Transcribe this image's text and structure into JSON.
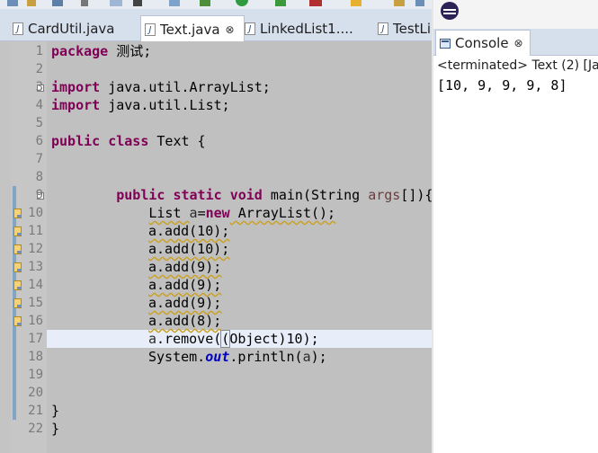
{
  "editor": {
    "tabs": [
      {
        "label": "CardUtil.java",
        "active": false
      },
      {
        "label": "Text.java",
        "active": true,
        "close": "⊗"
      },
      {
        "label": "LinkedList1....",
        "active": false
      },
      {
        "label": "TestLi",
        "active": false
      }
    ],
    "line_numbers": [
      "1",
      "2",
      "3",
      "4",
      "5",
      "6",
      "7",
      "8",
      "9",
      "10",
      "11",
      "12",
      "13",
      "14",
      "15",
      "16",
      "17",
      "18",
      "19",
      "20",
      "21",
      "22"
    ],
    "code": {
      "l1_kw": "package",
      "l1_rest": " 测试;",
      "l3_kw": "import",
      "l3_rest": " java.util.ArrayList;",
      "l4_kw": "import",
      "l4_rest": " java.util.List;",
      "l6_kw1": "public",
      "l6_kw2": "class",
      "l6_rest": " Text {",
      "l9_indent": "        ",
      "l9_kw1": "public",
      "l9_kw2": "static",
      "l9_kw3": "void",
      "l9_mid": " main(String ",
      "l9_par": "args",
      "l9_end": "[]){",
      "l10_indent": "            ",
      "l10_a": "List ",
      "l10_b": "a",
      "l10_c": "=",
      "l10_kw": "new",
      "l10_d": " ArrayList();",
      "l11": "a.add(10);",
      "l12": "a.add(10);",
      "l13": "a.add(9);",
      "l14": "a.add(9);",
      "l15": "a.add(9);",
      "l16": "a.add(8);",
      "l17_a": "a",
      "l17_b": ".remove(",
      "l17_c": "(",
      "l17_d": "Object)10);",
      "l18_a": "System.",
      "l18_fld": "out",
      "l18_b": ".println(",
      "l18_c": "a",
      "l18_d": ");",
      "l21": "}",
      "l22": "}"
    }
  },
  "console": {
    "tab_label": "Console",
    "close": "⊗",
    "status": "<terminated> Text (2) [Ja",
    "output": "[10, 9, 9, 9, 8]"
  }
}
